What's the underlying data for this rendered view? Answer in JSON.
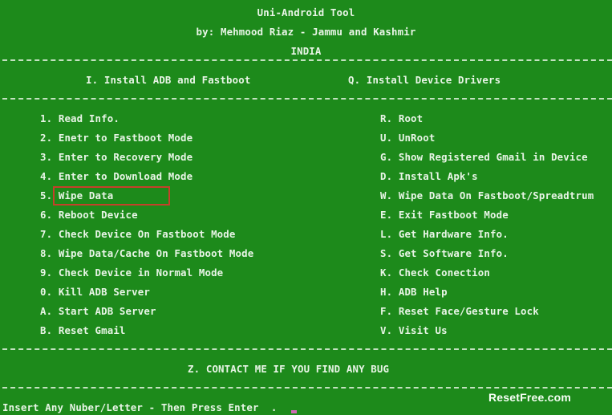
{
  "header": {
    "title": "Uni-Android Tool",
    "byline": "by: Mehmood Riaz - Jammu and Kashmir",
    "country": "INDIA"
  },
  "sections": {
    "left": "I. Install ADB and Fastboot",
    "right": "Q. Install Device Drivers"
  },
  "menu": {
    "left": [
      "1. Read Info.",
      "2. Enetr to Fastboot Mode",
      "3. Enter to Recovery Mode",
      "4. Enter to Download Mode",
      "5. Wipe Data",
      "6. Reboot Device",
      "7. Check Device On Fastboot Mode",
      "8. Wipe Data/Cache On Fastboot Mode",
      "9. Check Device in Normal Mode",
      "0. Kill ADB Server",
      "A. Start ADB Server",
      "B. Reset Gmail"
    ],
    "right": [
      "R. Root",
      "U. UnRoot",
      "G. Show Registered Gmail in Device",
      "D. Install Apk's",
      "W. Wipe Data On Fastboot/Spreadtrum",
      "E. Exit Fastboot Mode",
      "L. Get Hardware Info.",
      "S. Get Software Info.",
      "K. Check Conection",
      "H. ADB Help",
      "F. Reset Face/Gesture Lock",
      "V. Visit Us"
    ]
  },
  "footer": {
    "contact": "Z. CONTACT ME IF YOU FIND ANY BUG",
    "prompt": "Insert Any Nuber/Letter - Then Press Enter  ."
  },
  "watermark": "ResetFree.com",
  "colors": {
    "background": "#1d8a1b",
    "text": "#e8f5e6",
    "highlight_box": "#c5402a",
    "cursor": "#d06bb3"
  }
}
